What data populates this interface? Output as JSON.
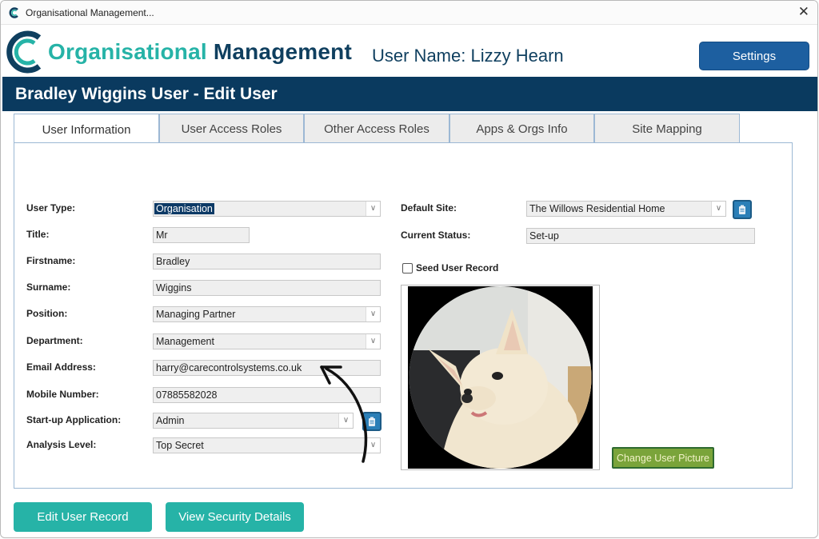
{
  "window": {
    "title": "Organisational Management..."
  },
  "header": {
    "brand_part1": "Organisational",
    "brand_part2": "Management",
    "user_name": "User Name: Lizzy Hearn",
    "settings_label": "Settings"
  },
  "banner": {
    "title": "Bradley Wiggins User - Edit User"
  },
  "tabs": [
    {
      "label": "User Information",
      "active": true
    },
    {
      "label": "User Access Roles",
      "active": false
    },
    {
      "label": "Other Access Roles",
      "active": false
    },
    {
      "label": "Apps & Orgs Info",
      "active": false
    },
    {
      "label": "Site Mapping",
      "active": false
    }
  ],
  "form": {
    "user_type": {
      "label": "User Type:",
      "value": "Organisation"
    },
    "title": {
      "label": "Title:",
      "value": "Mr"
    },
    "firstname": {
      "label": "Firstname:",
      "value": "Bradley"
    },
    "surname": {
      "label": "Surname:",
      "value": "Wiggins"
    },
    "position": {
      "label": "Position:",
      "value": "Managing Partner"
    },
    "department": {
      "label": "Department:",
      "value": "Management"
    },
    "email": {
      "label": "Email Address:",
      "value": "harry@carecontrolsystems.co.uk"
    },
    "mobile": {
      "label": "Mobile Number:",
      "value": "07885582028"
    },
    "startup_app": {
      "label": "Start-up Application:",
      "value": "Admin"
    },
    "analysis_level": {
      "label": "Analysis Level:",
      "value": "Top Secret"
    },
    "default_site": {
      "label": "Default Site:",
      "value": "The Willows Residential Home"
    },
    "current_status": {
      "label": "Current Status:",
      "value": "Set-up"
    },
    "seed_record": {
      "label": "Seed User Record",
      "checked": false
    }
  },
  "picture": {
    "change_label": "Change User Picture"
  },
  "actions": {
    "edit_label": "Edit User Record",
    "security_label": "View Security Details"
  },
  "colors": {
    "brand_teal": "#26b3a7",
    "brand_navy": "#0f3f5f",
    "banner": "#0a3a5f",
    "settings_button": "#1d5fa0",
    "change_picture_button": "#7aa43a"
  },
  "icons": [
    "app-logo-icon",
    "close-icon",
    "chevron-down-icon",
    "clipboard-icon",
    "annotation-arrow"
  ]
}
